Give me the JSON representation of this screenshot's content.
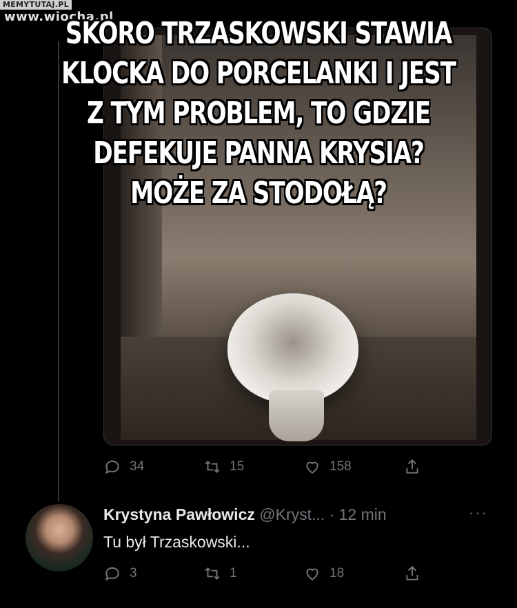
{
  "watermark": {
    "top": "MEMYTUTAJ.PL",
    "site": "www.wiocha.pl"
  },
  "meme_caption": {
    "lines": [
      "SKORO TRZASKOWSKI STAWIA",
      "KLOCKA DO PORCELANKI I JEST",
      "Z TYM PROBLEM, TO GDZIE",
      "DEFEKUJE PANNA KRYSIA?",
      "MOŻE ZA STODOŁĄ?"
    ]
  },
  "original_tweet": {
    "stats": {
      "replies": "34",
      "retweets": "15",
      "likes": "158"
    }
  },
  "reply": {
    "name": "Krystyna Pawłowicz",
    "handle": "@Kryst...",
    "time": "· 12 min",
    "more": "···",
    "text": "Tu był Trzaskowski...",
    "stats": {
      "replies": "3",
      "retweets": "1",
      "likes": "18"
    }
  },
  "icons": [
    "reply-icon",
    "retweet-icon",
    "like-icon",
    "share-icon",
    "more-icon"
  ],
  "colors": {
    "background": "#000000",
    "muted": "#71767b",
    "text": "#e7e9ea",
    "border": "#2f3336"
  }
}
